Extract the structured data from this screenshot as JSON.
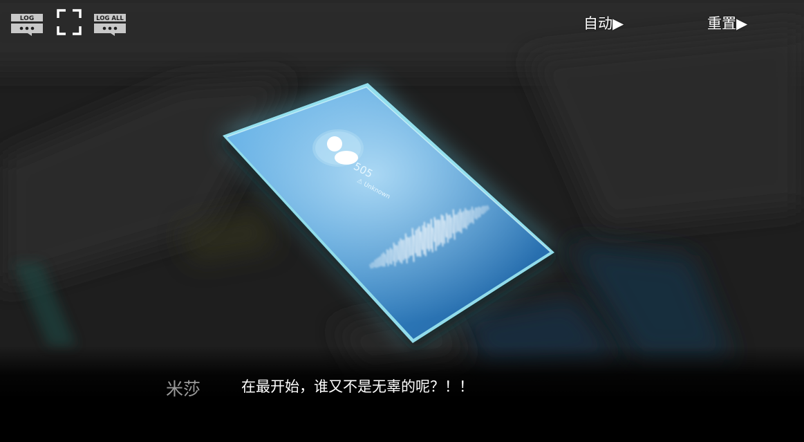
{
  "toolbar": {
    "log_label": "LOG",
    "log_all_label": "LOG ALL",
    "log_icon": "log-icon",
    "fullscreen_icon": "fullscreen-icon",
    "log_all_icon": "log-all-icon",
    "auto_label": "自动▶",
    "reset_label": "重置▶"
  },
  "phone": {
    "caller_number": "505",
    "caller_status": "Unknown",
    "avatar_icon": "user-avatar-icon",
    "waveform_icon": "voice-waveform-icon"
  },
  "dialogue": {
    "speaker": "米莎",
    "text": "在最开始，谁又不是无辜的呢？！！"
  },
  "colors": {
    "screen_glow": "#7fe3ff",
    "screen_blue": "#2f7fc0",
    "text_white": "#ffffff",
    "speaker_gray": "#9a9a9a",
    "icon_gray": "#c8c8c8"
  }
}
